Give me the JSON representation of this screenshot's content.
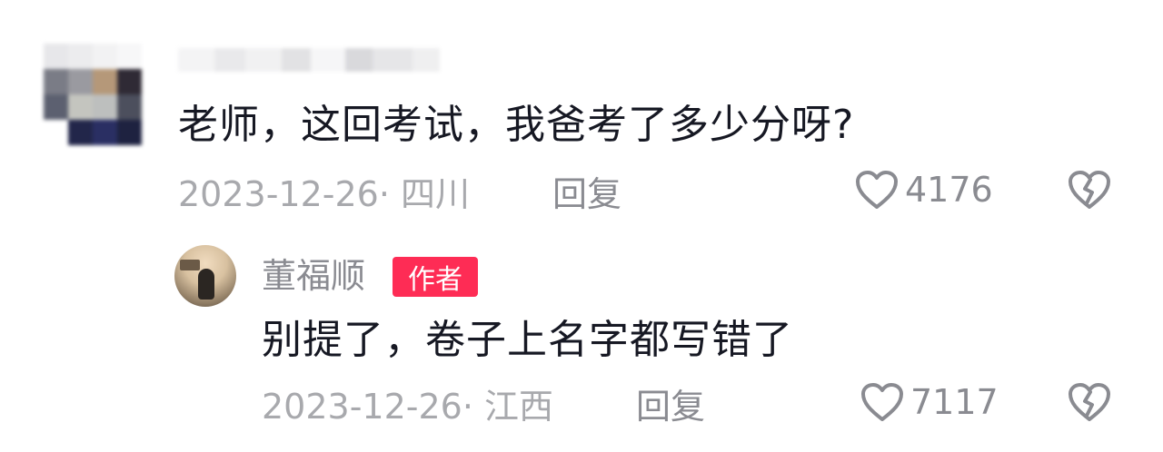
{
  "comments": [
    {
      "avatar_blurred": true,
      "username_blurred": true,
      "text": "老师，这回考试，我爸考了多少分呀?",
      "meta": "2023-12-26· 四川",
      "reply_label": "回复",
      "likes": "4176"
    }
  ],
  "reply": {
    "author": "董福顺",
    "badge": "作者",
    "text": "别提了，卷子上名字都写错了",
    "meta": "2023-12-26· 江西",
    "reply_label": "回复",
    "likes": "7117"
  },
  "colors": {
    "text_primary": "#161823",
    "text_meta": "#a8a9ad",
    "text_secondary": "#8a8b91",
    "badge_bg": "#fe2c55"
  },
  "icons": {
    "like": "heart-outline-icon",
    "dislike": "broken-heart-icon"
  }
}
